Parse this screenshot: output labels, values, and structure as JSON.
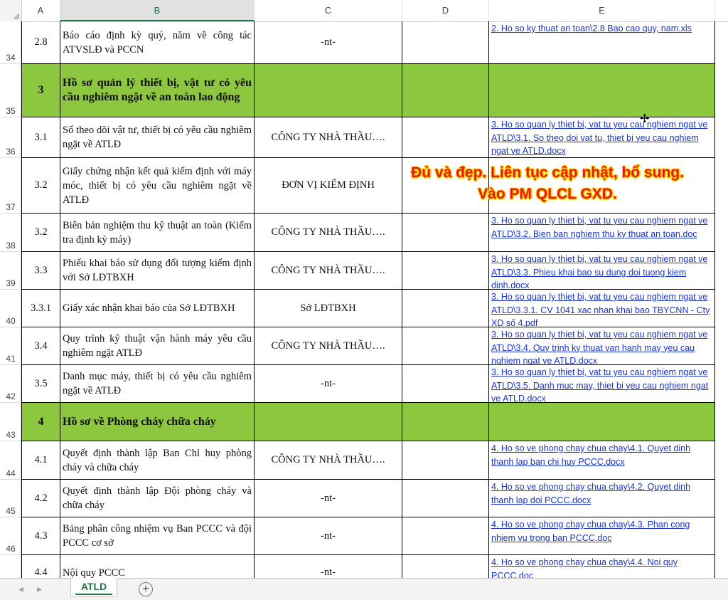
{
  "columns": [
    "A",
    "B",
    "C",
    "D",
    "E"
  ],
  "rows": [
    {
      "num": "34",
      "a": "2.8",
      "b": "Báo cáo định kỳ quý, năm về công tác ATVSLĐ và PCCN",
      "c": "-nt-",
      "e": "2. Ho so ky thuat an toan\\2.8 Bao cao quy, nam.xls"
    },
    {
      "num": "35",
      "a": "3",
      "b": "Hồ sơ quản lý thiết bị, vật tư có yêu cầu nghiêm ngặt về an toàn lao động",
      "c": "",
      "e": ""
    },
    {
      "num": "36",
      "a": "3.1",
      "b": "Sổ theo dõi vật tư, thiết bị có yêu cầu nghiêm ngặt về ATLĐ",
      "c": "CÔNG TY NHÀ THẦU….",
      "e": "3. Ho so quan ly thiet bi, vat tu yeu cau nghiem ngat ve ATLD\\3.1. So theo doi vat tu, thiet bi yeu cau nghiem ngat ve ATLD.docx"
    },
    {
      "num": "37",
      "a": "3.2",
      "b": "Giấy chứng nhận kết quả kiểm định với máy móc, thiết bị có yêu cầu nghiêm ngặt về ATLĐ",
      "c": "ĐƠN VỊ KIỂM ĐỊNH",
      "e": ""
    },
    {
      "num": "38",
      "a": "3.2",
      "b": "Biên bản nghiệm thu kỹ thuật an toàn (Kiểm tra định kỳ máy)",
      "c": "CÔNG TY NHÀ THẦU….",
      "e": "3. Ho so quan ly thiet bi, vat tu yeu cau nghiem ngat ve ATLD\\3.2. Bien ban nghiem thu ky thuat an toan.doc"
    },
    {
      "num": "39",
      "a": "3.3",
      "b": "Phiếu khai báo sử dụng đối tượng kiểm định với Sở LĐTBXH",
      "c": "CÔNG TY NHÀ THẦU….",
      "e": "3. Ho so quan ly thiet bi, vat tu yeu cau nghiem ngat ve ATLD\\3.3. Phieu khai bao su dung doi tuong kiem dinh.docx"
    },
    {
      "num": "40",
      "a": "3.3.1",
      "b": "Giấy xác nhận khai báo của Sở LĐTBXH",
      "c": "Sở LĐTBXH",
      "e": "3. Ho so quan ly thiet bi, vat tu yeu cau nghiem ngat ve ATLD\\3.3.1. CV 1041 xac nhan khai bao TBYCNN - Cty XD số 4.pdf"
    },
    {
      "num": "41",
      "a": "3.4",
      "b": " Quy trình kỹ thuật vận hành máy yêu cầu nghiêm ngặt ATLĐ",
      "c": "CÔNG TY NHÀ THẦU….",
      "e": "3. Ho so quan ly thiet bi, vat tu yeu cau nghiem ngat ve ATLD\\3.4. Quy trinh ky thuat van hanh may yeu cau nghiem ngat ve ATLD.docx"
    },
    {
      "num": "42",
      "a": "3.5",
      "b": "Danh mục máy, thiết bị có yêu cầu nghiêm ngặt về ATLĐ",
      "c": "-nt-",
      "e": "3. Ho so quan ly thiet bi, vat tu yeu cau nghiem ngat ve ATLD\\3.5. Danh muc may, thiet bi yeu cau nghiem ngat ve ATLD.docx"
    },
    {
      "num": "43",
      "a": "4",
      "b": "Hồ sơ về Phòng cháy chữa cháy",
      "c": "",
      "e": ""
    },
    {
      "num": "44",
      "a": "4.1",
      "b": "Quyết định thành lập Ban Chỉ huy phòng cháy và chữa cháy",
      "c": "CÔNG TY NHÀ THẦU….",
      "e": "4. Ho so ve phong chay chua chay\\4.1. Quyet dinh thanh lap ban chi huy PCCC.docx"
    },
    {
      "num": "45",
      "a": "4.2",
      "b": "Quyết định thành lập Đội phòng cháy và chữa cháy",
      "c": "-nt-",
      "e": "4. Ho so ve phong chay chua chay\\4.2. Quyet dinh thanh lap doi PCCC.docx"
    },
    {
      "num": "46",
      "a": "4.3",
      "b": "Bảng phân công nhiệm vụ Ban PCCC và đội PCCC cơ sở",
      "c": "-nt-",
      "e": "4. Ho so ve phong chay chua chay\\4.3. Phan cong nhiem vu trong ban PCCC.doc"
    },
    {
      "num": "47",
      "a": "4.4",
      "b": "Nội quy PCCC",
      "c": "-nt-",
      "e": "4. Ho so ve phong chay chua chay\\4.4. Noi quy PCCC.doc"
    }
  ],
  "overlay": {
    "line1": "Đủ và đẹp. Liên tục cập nhật, bổ sung.",
    "line2": "Vào PM QLCL GXD."
  },
  "tabs": {
    "active": "ATLD"
  },
  "colors": {
    "section_fill": "#8dc63f",
    "link": "#1a34c8",
    "overlay_text": "#e21a1a",
    "overlay_outline": "#ffd400",
    "accent": "#217346"
  }
}
